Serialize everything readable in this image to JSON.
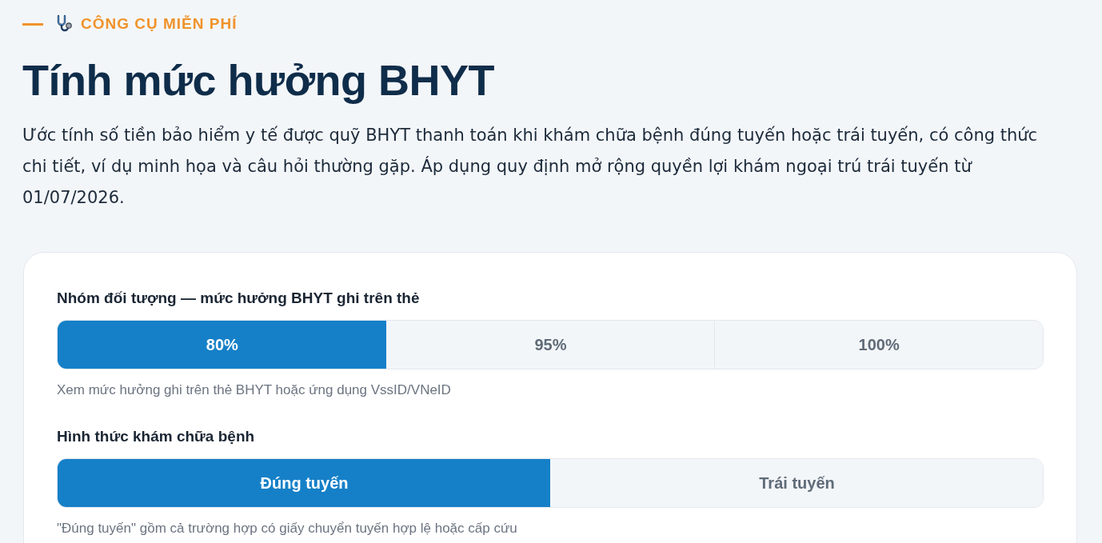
{
  "eyebrow": {
    "text": "CÔNG CỤ MIỄN PHÍ"
  },
  "title": "Tính mức hưởng BHYT",
  "description": "Ước tính số tiền bảo hiểm y tế được quỹ BHYT thanh toán khi khám chữa bệnh đúng tuyến hoặc trái tuyến, có công thức chi tiết, ví dụ minh họa và câu hỏi thường gặp. Áp dụng quy định mở rộng quyền lợi khám ngoại trú trái tuyến từ 01/07/2026.",
  "form": {
    "fields": [
      {
        "label": "Nhóm đối tượng — mức hưởng BHYT ghi trên thẻ",
        "options": [
          {
            "label": "80%",
            "selected": true
          },
          {
            "label": "95%",
            "selected": false
          },
          {
            "label": "100%",
            "selected": false
          }
        ],
        "hint": "Xem mức hưởng ghi trên thẻ BHYT hoặc ứng dụng VssID/VNeID"
      },
      {
        "label": "Hình thức khám chữa bệnh",
        "options": [
          {
            "label": "Đúng tuyến",
            "selected": true
          },
          {
            "label": "Trái tuyến",
            "selected": false
          }
        ],
        "hint": "\"Đúng tuyến\" gồm cả trường hợp có giấy chuyển tuyến hợp lệ hoặc cấp cứu"
      }
    ]
  }
}
